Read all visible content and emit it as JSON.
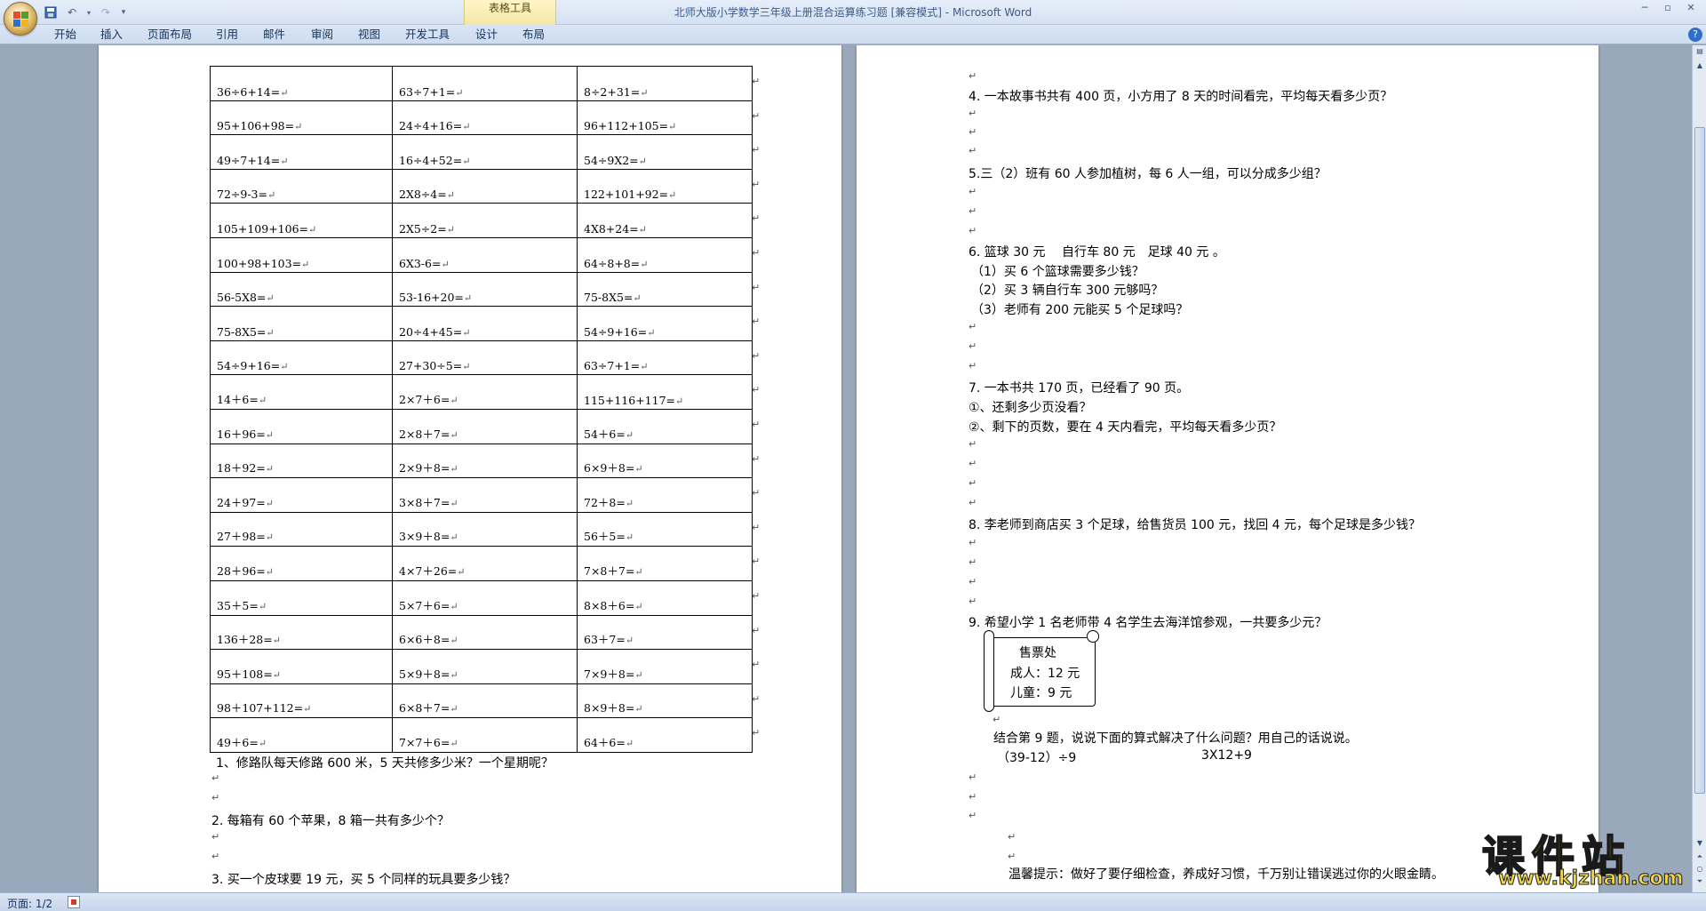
{
  "window": {
    "title": "北师大版小学数学三年级上册混合运算练习题 [兼容模式]",
    "app_name": "Microsoft Word",
    "context_group": "表格工具"
  },
  "ribbon": {
    "tabs": [
      "开始",
      "插入",
      "页面布局",
      "引用",
      "邮件",
      "审阅",
      "视图",
      "开发工具",
      "设计",
      "布局"
    ]
  },
  "table_rows": [
    [
      "36÷6+14=",
      "63÷7+1=",
      "8÷2+31="
    ],
    [
      "95+106+98=",
      "24÷4+16=",
      "96+112+105="
    ],
    [
      "49÷7+14=",
      "16÷4+52=",
      "54÷9X2="
    ],
    [
      "72÷9-3=",
      "2X8÷4=",
      "122+101+92="
    ],
    [
      "105+109+106=",
      "2X5÷2=",
      "4X8+24="
    ],
    [
      "100+98+103=",
      "6X3-6=",
      "64÷8+8="
    ],
    [
      "56-5X8=",
      "53-16+20=",
      "75-8X5="
    ],
    [
      "75-8X5=",
      "20÷4+45=",
      "54÷9+16="
    ],
    [
      "54÷9+16=",
      "27+30÷5=",
      "63÷7+1="
    ],
    [
      "14＋6=",
      "2×7＋6=",
      "115+116+117="
    ],
    [
      "16＋96=",
      "2×8＋7=",
      "54＋6="
    ],
    [
      "18＋92=",
      "2×9＋8=",
      "6×9＋8="
    ],
    [
      "24＋97=",
      "3×8＋7=",
      "72＋8="
    ],
    [
      "27＋98=",
      "3×9＋8=",
      "56＋5="
    ],
    [
      "28＋96=",
      "4×7＋26=",
      "7×8＋7="
    ],
    [
      "35＋5=",
      "5×7＋6=",
      "8×8＋6="
    ],
    [
      "136＋28=",
      "6×6＋8=",
      "63＋7="
    ],
    [
      "95＋108=",
      "5×9＋8=",
      "7×9＋8="
    ],
    [
      "98＋107+112=",
      "6×8＋7=",
      "8×9＋8="
    ],
    [
      "49＋6=",
      "7×7＋6=",
      "64＋6="
    ]
  ],
  "left_questions": {
    "q1": "1、修路队每天修路 600 米，5 天共修多少米？一个星期呢？",
    "q2": "2. 每箱有 60 个苹果，8 箱一共有多少个？",
    "q3": "3. 买一个皮球要 19 元，买 5 个同样的玩具要多少钱？"
  },
  "right_questions": {
    "q4": "4. 一本故事书共有 400 页，小方用了 8 天的时间看完，平均每天看多少页？",
    "q5": "5.三（2）班有 60 人参加植树，每 6 人一组，可以分成多少组？",
    "q6": "6. 篮球 30 元　 自行车 80 元　足球 40 元 。",
    "q6_1": "（1）买 6 个篮球需要多少钱？",
    "q6_2": "（2）买 3 辆自行车 300 元够吗？",
    "q6_3": "（3）老师有 200 元能买 5 个足球吗？",
    "q7": "7. 一本书共 170 页，已经看了 90 页。",
    "q7_1": "①、还剩多少页没看？",
    "q7_2": "②、剩下的页数，要在 4 天内看完，平均每天看多少页？",
    "q8": "8. 李老师到商店买 3 个足球，给售货员 100 元，找回 4 元，每个足球是多少钱？",
    "q9": "9. 希望小学 1 名老师带 4 名学生去海洋馆参观，一共要多少元？",
    "ticket_title": "售票处",
    "ticket_adult": "成人：12 元",
    "ticket_child": "儿童：9 元",
    "q9_followup": "结合第 9 题，说说下面的算式解决了什么问题？用自己的话说说。",
    "expr1": "（39-12）÷9",
    "expr2": "3X12+9",
    "tip": "温馨提示：做好了要仔细检查，养成好习惯，千万别让错误逃过你的火眼金睛。"
  },
  "status": {
    "page": "页面: 1/2"
  },
  "watermark": {
    "cn": "课件站",
    "url": "www.kjzhan.com"
  },
  "para_mark": "↵"
}
